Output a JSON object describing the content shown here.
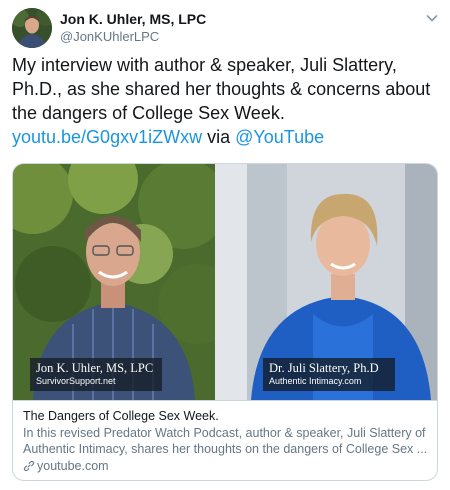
{
  "author": {
    "name": "Jon K. Uhler, MS, LPC",
    "handle": "@JonKUhlerLPC"
  },
  "tweet": {
    "text_lines": [
      "My interview with author & speaker, Juli Slattery,",
      "Ph.D.,  as she shared her thoughts & concerns about",
      "the dangers of College Sex Week."
    ],
    "link": "youtu.be/G0gxv1iZWxw",
    "via": "via",
    "mention": "@YouTube"
  },
  "card": {
    "left_caption": {
      "name": "Jon K. Uhler, MS, LPC",
      "sub": "SurvivorSupport.net"
    },
    "right_caption": {
      "name": "Dr. Juli Slattery, Ph.D",
      "sub": "Authentic Intimacy.com"
    },
    "title": "The Dangers of College Sex Week.",
    "description_lines": [
      "In this revised Predator Watch Podcast, author & speaker, Juli Slattery of",
      "Authentic Intimacy, shares her thoughts on the dangers of College Sex ..."
    ],
    "domain": "youtube.com"
  },
  "icons": {
    "caret": "chevron-down-icon",
    "domain": "link-icon"
  },
  "colors": {
    "link": "#1b95e0",
    "secondary_text": "#657786",
    "border": "#ccd6dd"
  }
}
